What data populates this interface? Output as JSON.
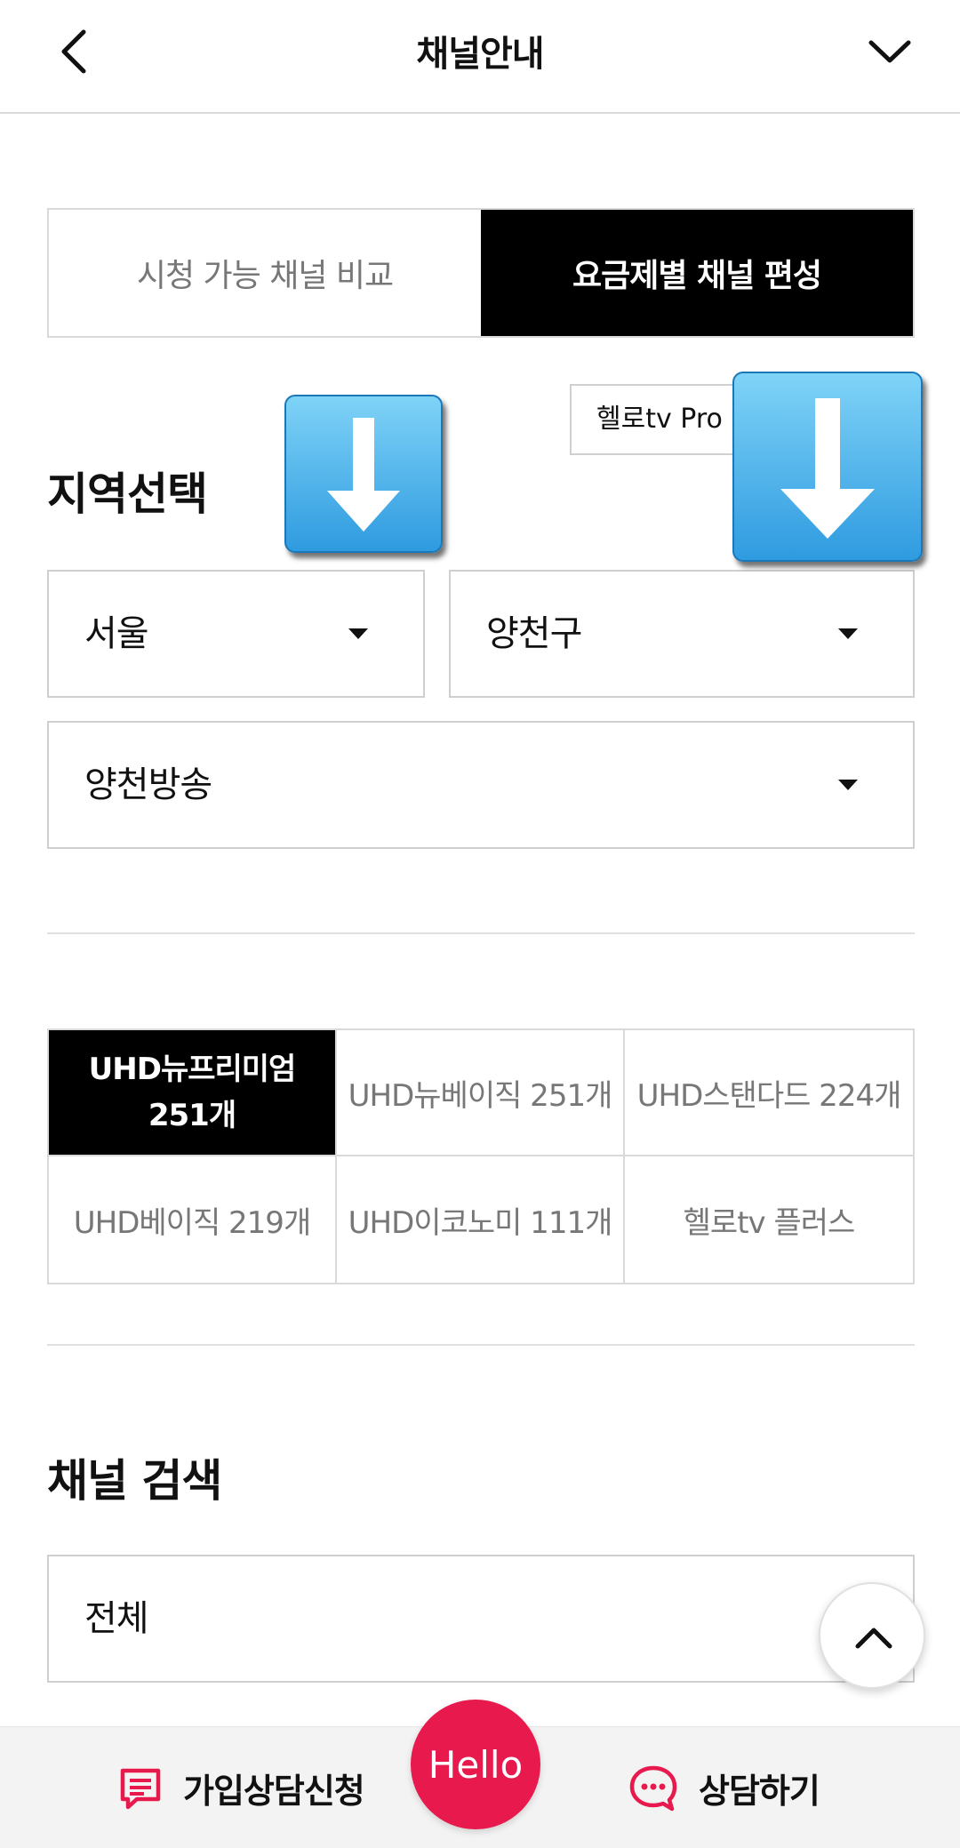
{
  "header": {
    "title": "채널안내"
  },
  "tabs": [
    {
      "label": "시청 가능 채널 비교",
      "active": false
    },
    {
      "label": "요금제별 채널 편성",
      "active": true
    }
  ],
  "region": {
    "title": "지역선택",
    "plan_chip": "헬로tv Pro 기",
    "city": "서울",
    "district": "양천구",
    "provider": "양천방송"
  },
  "plans": [
    {
      "label": "UHD뉴프리미엄 251개",
      "active": true
    },
    {
      "label": "UHD뉴베이직 251개",
      "active": false
    },
    {
      "label": "UHD스탠다드 224개",
      "active": false
    },
    {
      "label": "UHD베이직 219개",
      "active": false
    },
    {
      "label": "UHD이코노미 111개",
      "active": false
    },
    {
      "label": "헬로tv 플러스",
      "active": false
    }
  ],
  "channel_search": {
    "title": "채널 검색",
    "selected": "전체"
  },
  "bottom_bar": {
    "signup_label": "가입상담신청",
    "hello_label": "Hello",
    "consult_label": "상담하기"
  },
  "colors": {
    "accent": "#e8194d",
    "active_bg": "#000000",
    "border": "#d9d9d9"
  }
}
